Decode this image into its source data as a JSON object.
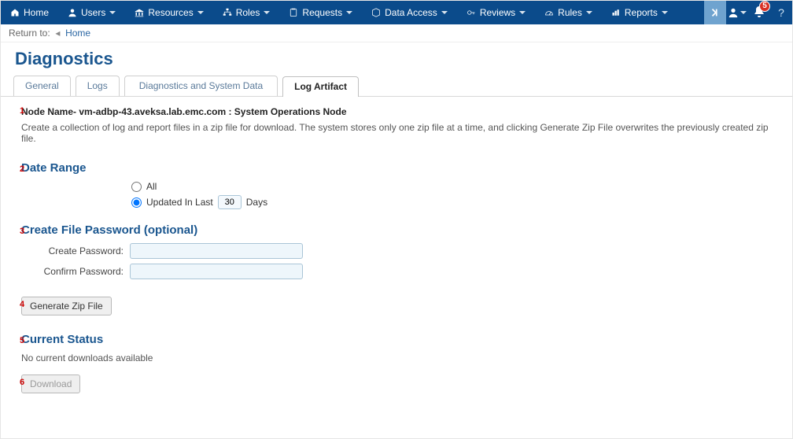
{
  "nav": {
    "items": [
      {
        "label": "Home",
        "icon": "home"
      },
      {
        "label": "Users",
        "icon": "user"
      },
      {
        "label": "Resources",
        "icon": "bank"
      },
      {
        "label": "Roles",
        "icon": "org"
      },
      {
        "label": "Requests",
        "icon": "clipboard"
      },
      {
        "label": "Data Access",
        "icon": "cube"
      },
      {
        "label": "Reviews",
        "icon": "key"
      },
      {
        "label": "Rules",
        "icon": "gauge"
      },
      {
        "label": "Reports",
        "icon": "chart"
      }
    ],
    "notification_count": "5"
  },
  "breadcrumb": {
    "prefix": "Return to:",
    "link": "Home"
  },
  "page_title": "Diagnostics",
  "tabs": [
    {
      "label": "General"
    },
    {
      "label": "Logs"
    },
    {
      "label": "Diagnostics and System Data"
    },
    {
      "label": "Log Artifact",
      "active": true
    }
  ],
  "annotations": {
    "a1": "1",
    "a2": "2",
    "a3": "3",
    "a4": "4",
    "a5": "5",
    "a6": "6"
  },
  "node": {
    "label_prefix": "Node Name- ",
    "name": "vm-adbp-43.aveksa.lab.emc.com",
    "role": "System Operations Node",
    "description": "Create a collection of log and report files in a zip file for download. The system stores only one zip file at a time, and clicking Generate Zip File overwrites the previously created zip file."
  },
  "date_range": {
    "title": "Date Range",
    "opt_all": "All",
    "opt_updated_prefix": "Updated In Last",
    "days_value": "30",
    "days_suffix": "Days",
    "selected": "updated"
  },
  "password": {
    "title": "Create File Password (optional)",
    "create_label": "Create Password:",
    "confirm_label": "Confirm Password:",
    "create_value": "",
    "confirm_value": ""
  },
  "generate_btn": "Generate Zip File",
  "status": {
    "title": "Current Status",
    "text": "No current downloads available"
  },
  "download_btn": "Download"
}
